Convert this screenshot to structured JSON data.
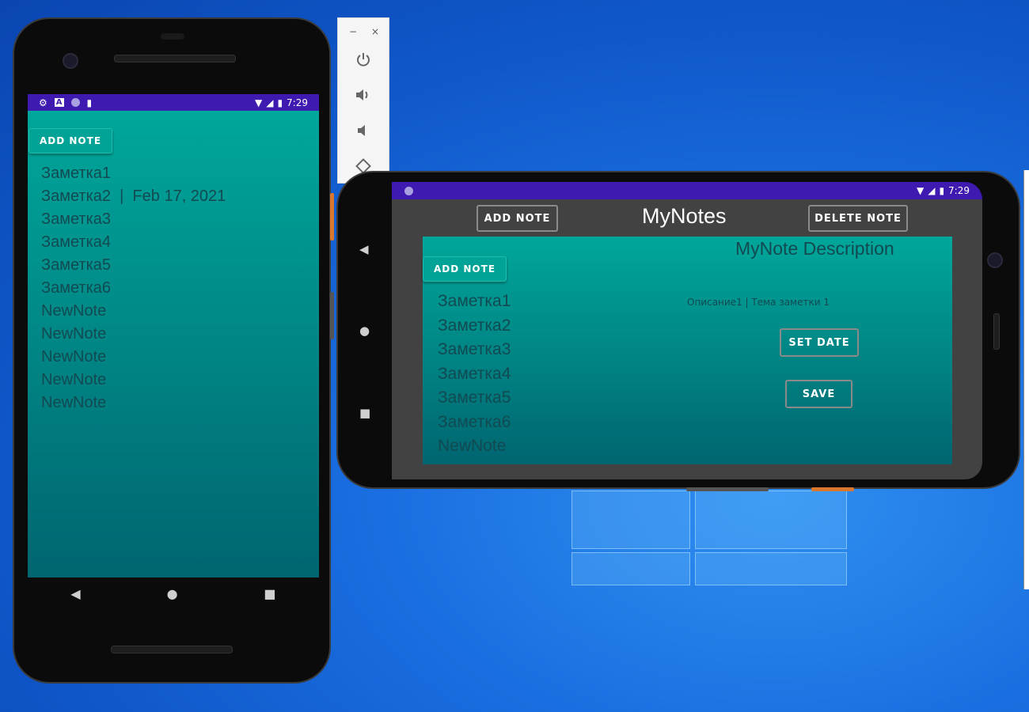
{
  "status_bar": {
    "time": "7:29"
  },
  "portrait": {
    "add_note_label": "ADD NOTE",
    "notes": [
      "Заметка1",
      "Заметка2  |  Feb 17, 2021",
      "Заметка3",
      "Заметка4",
      "Заметка5",
      "Заметка6",
      "NewNote",
      "NewNote",
      "NewNote",
      "NewNote",
      "NewNote"
    ]
  },
  "landscape": {
    "title": "MyNotes",
    "toolbar_add_note_label": "ADD NOTE",
    "toolbar_delete_note_label": "DELETE NOTE",
    "add_note_label": "ADD NOTE",
    "notes": [
      "Заметка1",
      "Заметка2",
      "Заметка3",
      "Заметка4",
      "Заметка5",
      "Заметка6",
      "NewNote"
    ],
    "description_title": "MyNote Description",
    "description_text": "Описание1 | Тема заметки 1",
    "set_date_label": "SET DATE",
    "save_label": "SAVE"
  },
  "emulator_toolbar": {
    "minimize_symbol": "−",
    "close_symbol": "×",
    "tools": [
      "power-icon",
      "volume-up-icon",
      "volume-down-icon",
      "rotate-icon"
    ]
  },
  "nav_icons": [
    "back-icon",
    "home-icon",
    "recents-icon"
  ]
}
